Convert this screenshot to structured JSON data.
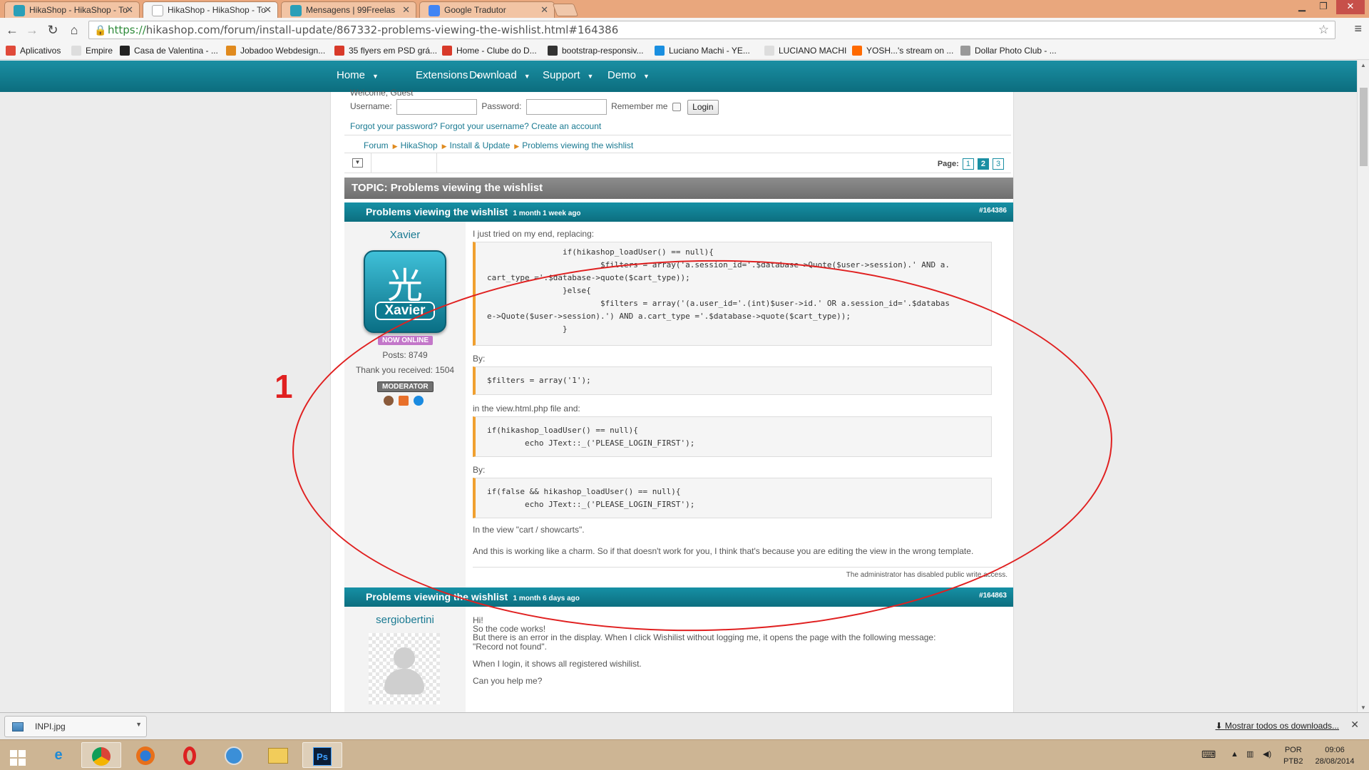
{
  "browser": {
    "tabs": [
      {
        "label": "HikaShop - HikaShop - To",
        "color": "#2a9fb8",
        "active": false
      },
      {
        "label": "HikaShop - HikaShop - To",
        "color": "#ffffff",
        "active": true
      },
      {
        "label": "Mensagens | 99Freelas",
        "color": "#2a9fb8",
        "active": false
      },
      {
        "label": "Google Tradutor",
        "color": "#4285f4",
        "active": false
      }
    ],
    "url_scheme": "https://",
    "url_rest": "hikashop.com/forum/install-update/867332-problems-viewing-the-wishlist.html#164386",
    "bookmarks": [
      {
        "label": "Aplicativos",
        "color": "#e04a3a"
      },
      {
        "label": "Empire",
        "color": "#dddddd"
      },
      {
        "label": "Casa de Valentina - ...",
        "color": "#222222"
      },
      {
        "label": "Jobadoo Webdesign...",
        "color": "#e08a1e"
      },
      {
        "label": "35 flyers em PSD grá...",
        "color": "#d83a2a"
      },
      {
        "label": "Home - Clube do D...",
        "color": "#d83a2a"
      },
      {
        "label": "bootstrap-responsiv...",
        "color": "#333333"
      },
      {
        "label": "Luciano Machi - YE...",
        "color": "#1a8fe0"
      },
      {
        "label": "LUCIANO MACHI",
        "color": "#dddddd"
      },
      {
        "label": "YOSH...'s stream on ...",
        "color": "#ff6a00"
      },
      {
        "label": "Dollar Photo Club - ...",
        "color": "#999999"
      }
    ]
  },
  "nav": {
    "items": [
      "Home",
      "Extensions",
      "Download",
      "Support",
      "Demo"
    ]
  },
  "login": {
    "welcome": "Welcome, Guest",
    "username_label": "Username:",
    "password_label": "Password:",
    "remember_label": "Remember me",
    "login_button": "Login",
    "forgot_password": "Forgot your password?",
    "forgot_username": "Forgot your username?",
    "create_account": "Create an account"
  },
  "breadcrumb": [
    "Forum",
    "HikaShop",
    "Install & Update",
    "Problems viewing the wishlist"
  ],
  "pager": {
    "label": "Page:",
    "pages": [
      "1",
      "2",
      "3"
    ],
    "current": "2"
  },
  "topic": {
    "title": "TOPIC: Problems viewing the wishlist"
  },
  "post1": {
    "title": "Problems viewing the wishlist",
    "date": "1 month 1 week ago",
    "id": "#164386",
    "author": "Xavier",
    "avatar_text": "Xavier",
    "avatar_glyph": "光",
    "status": "NOW ONLINE",
    "posts": "Posts: 8749",
    "thanks": "Thank you received: 1504",
    "role": "MODERATOR",
    "intro": "I just tried on my end, replacing:",
    "code1": [
      "                if(hikashop_loadUser() == null){",
      "                        $filters = array('a.session_id='.$database->Quote($user->session).' AND a.",
      "cart_type ='.$database->quote($cart_type));",
      "                }else{",
      "                        $filters = array('(a.user_id='.(int)$user->id.' OR a.session_id='.$databas",
      "e->Quote($user->session).') AND a.cart_type ='.$database->quote($cart_type));",
      "                }"
    ],
    "by1": "By:",
    "code2": [
      "$filters = array('1');"
    ],
    "mid": "in the view.html.php file and:",
    "code3": [
      "if(hikashop_loadUser() == null){",
      "        echo JText::_('PLEASE_LOGIN_FIRST');"
    ],
    "by2": "By:",
    "code4": [
      "if(false && hikashop_loadUser() == null){",
      "        echo JText::_('PLEASE_LOGIN_FIRST');"
    ],
    "view_text": "In the view \"cart / showcarts\".",
    "closing": "And this is working like a charm. So if that doesn't work for you, I think that's because you are editing the view in the wrong template.",
    "admin_note": "The administrator has disabled public write access."
  },
  "post2": {
    "title": "Problems viewing the wishlist",
    "date": "1 month 6 days ago",
    "id": "#164863",
    "author": "sergiobertini",
    "lines": [
      "Hi!",
      "So the code works!",
      "But there is an error in the display. When I click Wishilist without logging me, it opens the page with the following message:",
      "\"Record not found\".",
      "",
      "When I login, it shows all registered wishilist.",
      "",
      "Can you help me?"
    ]
  },
  "annotation": {
    "number": "1",
    "color": "#e02020"
  },
  "downloads": {
    "file": "INPI.jpg",
    "show_all": "Mostrar todos os downloads..."
  },
  "taskbar": {
    "lang": "POR",
    "layout": "PTB2",
    "time": "09:06",
    "date": "28/08/2014"
  }
}
